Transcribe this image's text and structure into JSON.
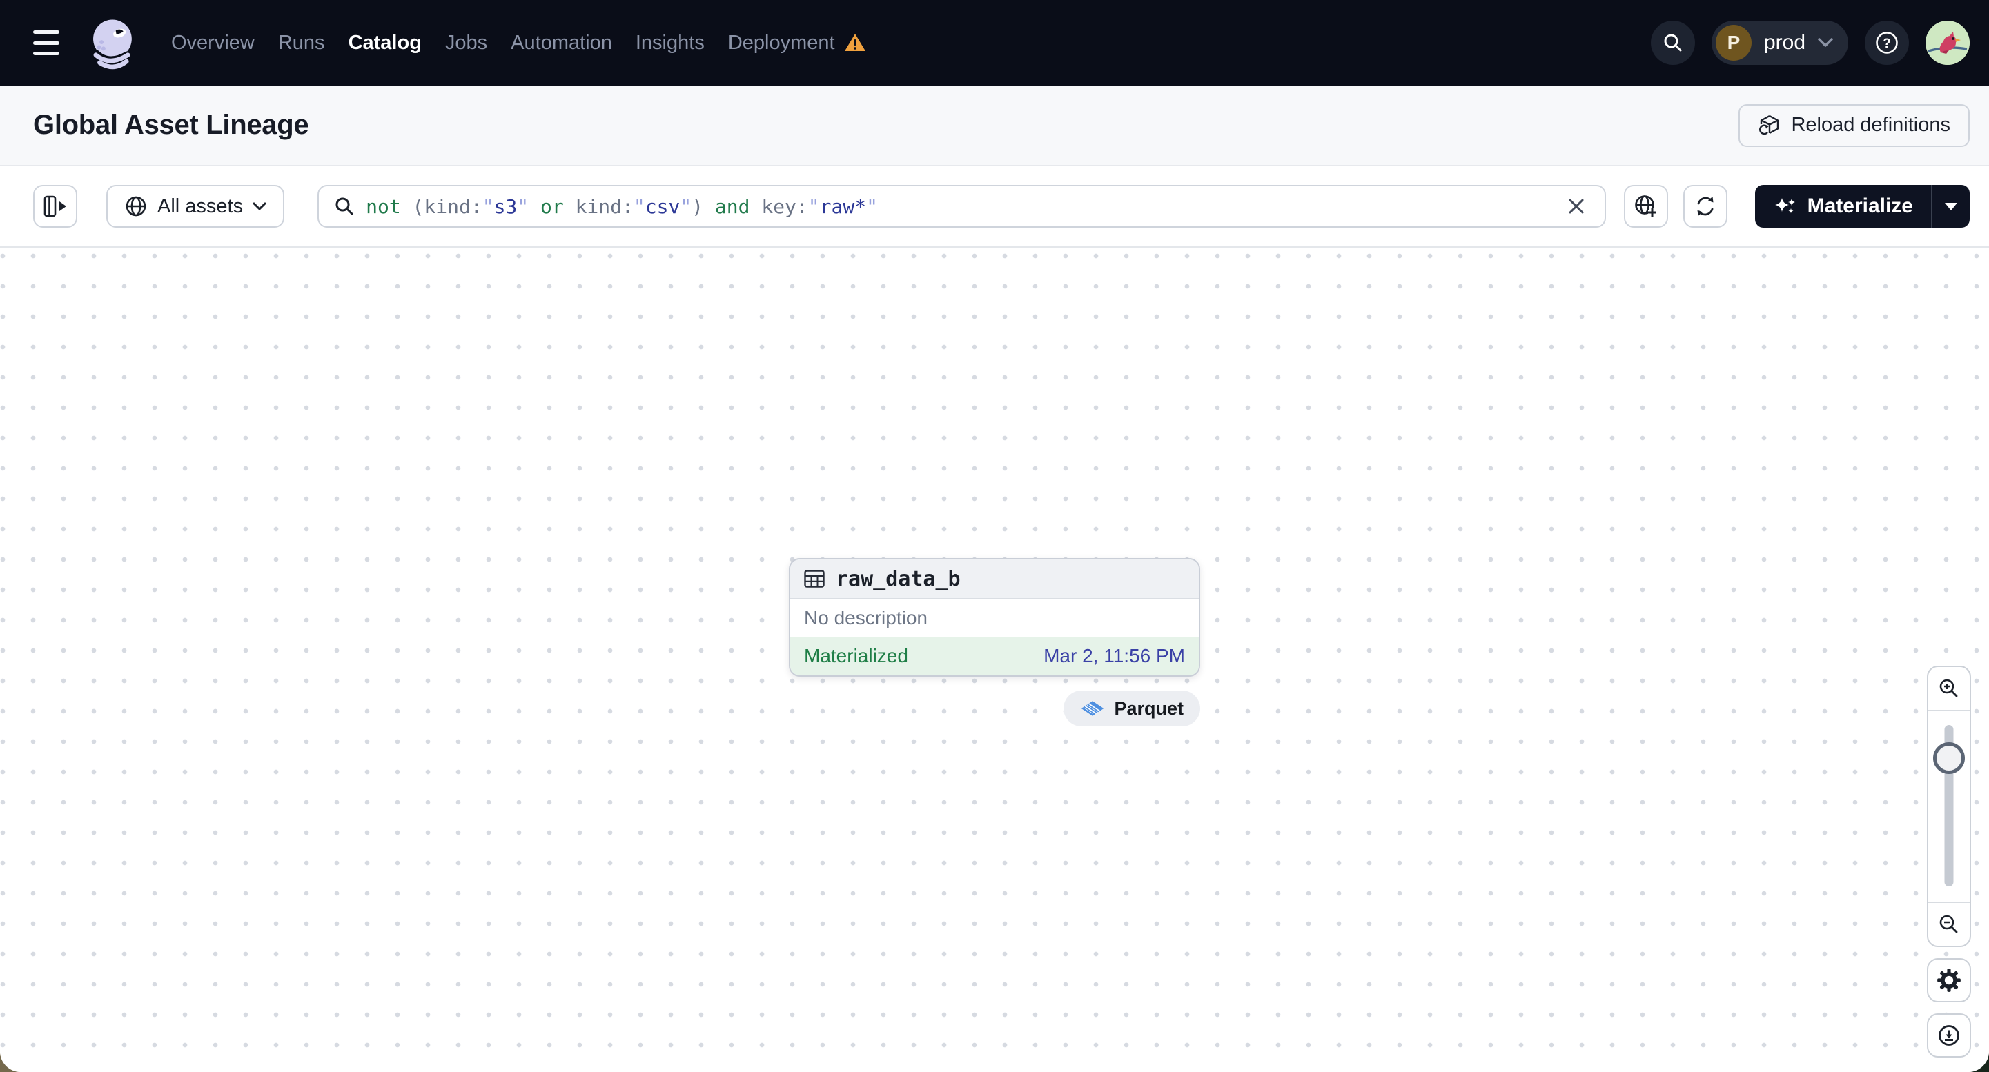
{
  "navbar": {
    "items": [
      {
        "label": "Overview"
      },
      {
        "label": "Runs"
      },
      {
        "label": "Catalog",
        "active": true
      },
      {
        "label": "Jobs"
      },
      {
        "label": "Automation"
      },
      {
        "label": "Insights"
      },
      {
        "label": "Deployment",
        "warning": true
      }
    ],
    "environment": {
      "avatar_initial": "P",
      "name": "prod"
    }
  },
  "page_header": {
    "title": "Global Asset Lineage",
    "reload_button": "Reload definitions"
  },
  "toolbar": {
    "asset_scope": {
      "label": "All assets"
    },
    "query": {
      "value": "not (kind:\"s3\" or kind:\"csv\") and key:\"raw*\"",
      "tokens": [
        {
          "text": "not",
          "type": "keyword"
        },
        {
          "text": " (",
          "type": "punct"
        },
        {
          "text": "kind:",
          "type": "field"
        },
        {
          "text": "\"",
          "type": "quote"
        },
        {
          "text": "s3",
          "type": "value"
        },
        {
          "text": "\"",
          "type": "quote"
        },
        {
          "text": " or ",
          "type": "keyword"
        },
        {
          "text": "kind:",
          "type": "field"
        },
        {
          "text": "\"",
          "type": "quote"
        },
        {
          "text": "csv",
          "type": "value"
        },
        {
          "text": "\"",
          "type": "quote"
        },
        {
          "text": ")",
          "type": "punct"
        },
        {
          "text": " and ",
          "type": "keyword"
        },
        {
          "text": "key:",
          "type": "field"
        },
        {
          "text": "\"",
          "type": "quote"
        },
        {
          "text": "raw*",
          "type": "value"
        },
        {
          "text": "\"",
          "type": "quote"
        }
      ]
    },
    "materialize": {
      "label": "Materialize"
    }
  },
  "lineage": {
    "node": {
      "name": "raw_data_b",
      "description": "No description",
      "status": "Materialized",
      "materialized_at": "Mar 2, 11:56 PM",
      "kind_tag": "Parquet"
    }
  },
  "colors": {
    "navbar_bg": "#0a0d18",
    "warning_orange": "#f0a13e",
    "status_green": "#1e7e46",
    "status_bg_green": "#e6f3e9",
    "timestamp_blue": "#3a41a6",
    "query_keyword_green": "#207a4b",
    "query_field_gray": "#6a7385",
    "query_value_indigo": "#2b3796",
    "query_quote_periwinkle": "#98a2dd",
    "materialize_button_bg": "#0e1322",
    "parquet_blue": "#4e8fe0",
    "logo_lavender": "#d3d2f1"
  }
}
